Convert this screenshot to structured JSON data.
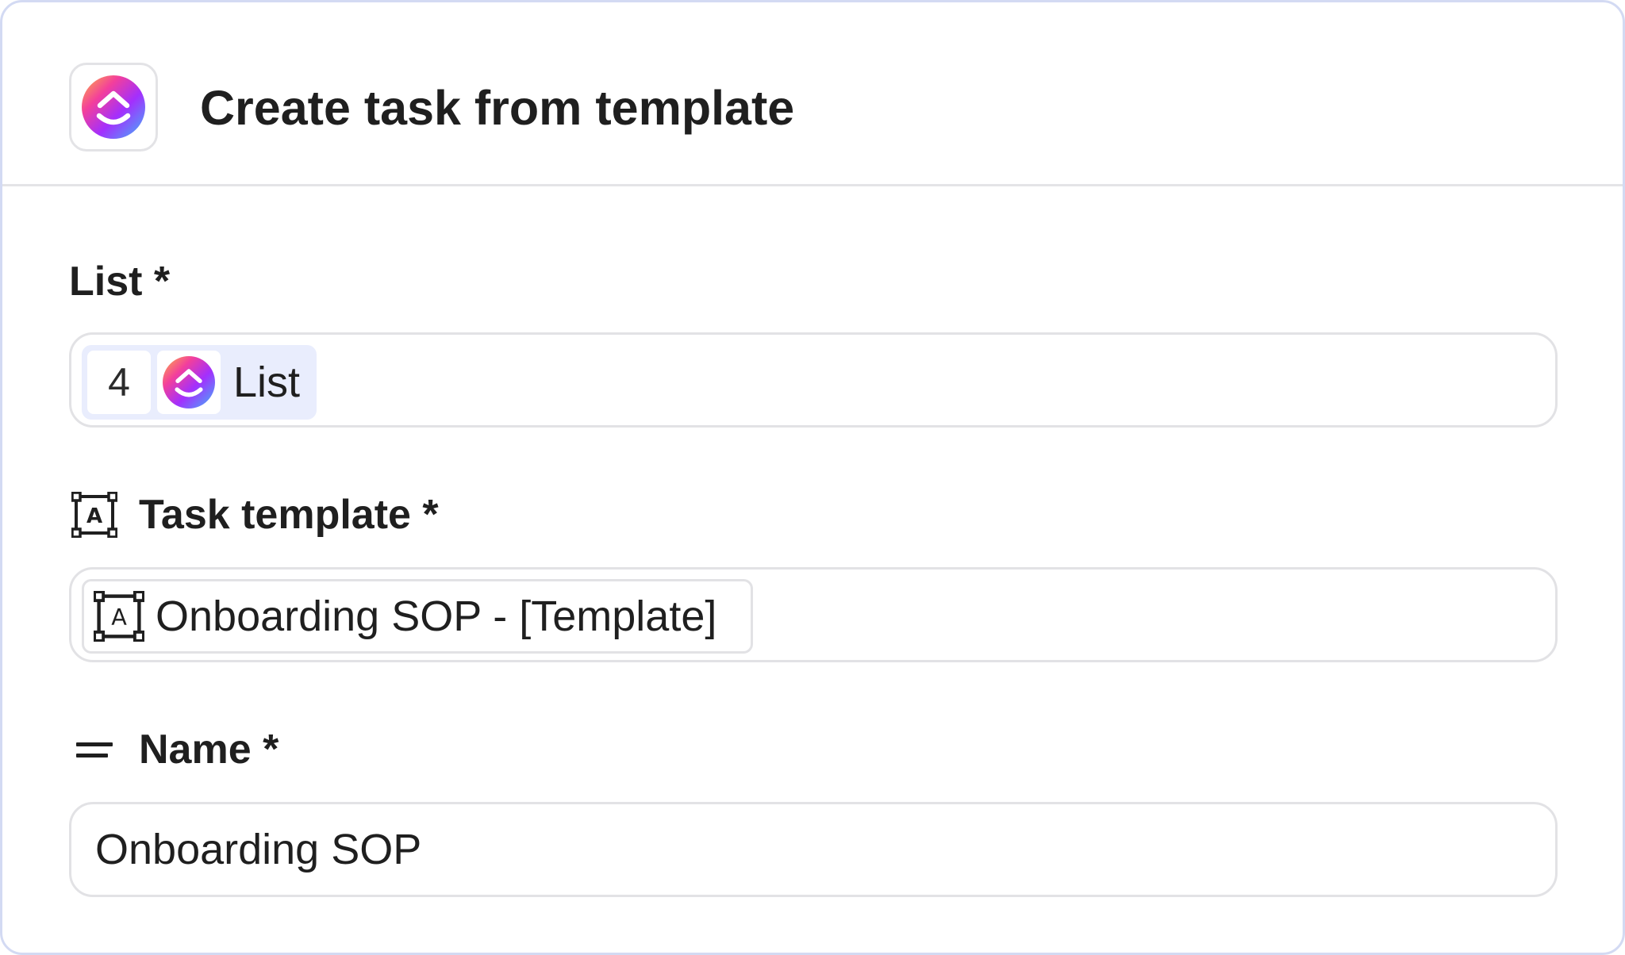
{
  "header": {
    "app_icon": "clickup-logo",
    "title": "Create task from template"
  },
  "fields": {
    "list": {
      "label": "List *",
      "chip_count": "4",
      "chip_icon": "clickup-logo",
      "chip_text": "List"
    },
    "task_template": {
      "label_icon": "template-icon",
      "label": "Task template *",
      "chip_icon": "template-icon",
      "chip_text": "Onboarding SOP - [Template]"
    },
    "name": {
      "label_icon": "text-lines-icon",
      "label": "Name *",
      "value": "Onboarding SOP"
    }
  },
  "colors": {
    "border_accent": "#d3daf3",
    "chip_bg": "#e9edfd",
    "text": "#1f1f1f"
  }
}
